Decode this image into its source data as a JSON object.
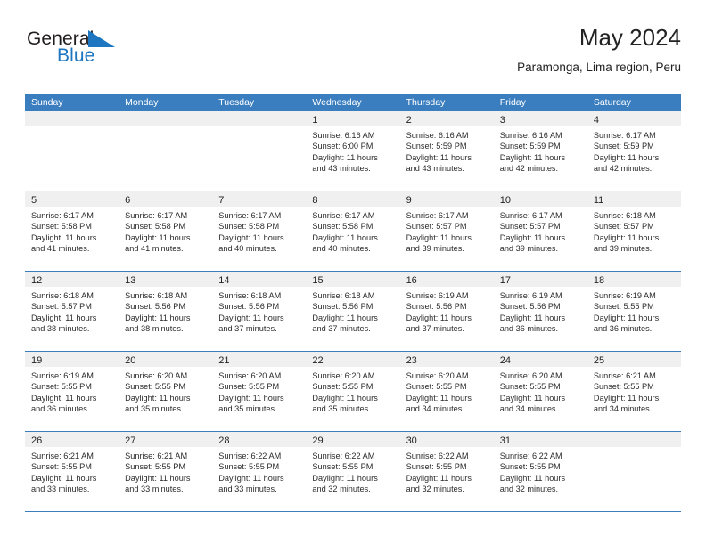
{
  "brand": {
    "line1": "General",
    "line2": "Blue",
    "mark_color": "#1d76bf"
  },
  "header": {
    "title": "May 2024",
    "subtitle": "Paramonga, Lima region, Peru"
  },
  "theme": {
    "header_bg": "#3b7ebf",
    "header_text": "#ffffff",
    "date_band_bg": "#f0f0f0",
    "row_divider": "#3b7ebf"
  },
  "weekdays": [
    "Sunday",
    "Monday",
    "Tuesday",
    "Wednesday",
    "Thursday",
    "Friday",
    "Saturday"
  ],
  "weeks": [
    [
      {
        "day": "",
        "sunrise": "",
        "sunset": "",
        "daylight1": "",
        "daylight2": "",
        "empty": true
      },
      {
        "day": "",
        "sunrise": "",
        "sunset": "",
        "daylight1": "",
        "daylight2": "",
        "empty": true
      },
      {
        "day": "",
        "sunrise": "",
        "sunset": "",
        "daylight1": "",
        "daylight2": "",
        "empty": true
      },
      {
        "day": "1",
        "sunrise": "Sunrise: 6:16 AM",
        "sunset": "Sunset: 6:00 PM",
        "daylight1": "Daylight: 11 hours",
        "daylight2": "and 43 minutes."
      },
      {
        "day": "2",
        "sunrise": "Sunrise: 6:16 AM",
        "sunset": "Sunset: 5:59 PM",
        "daylight1": "Daylight: 11 hours",
        "daylight2": "and 43 minutes."
      },
      {
        "day": "3",
        "sunrise": "Sunrise: 6:16 AM",
        "sunset": "Sunset: 5:59 PM",
        "daylight1": "Daylight: 11 hours",
        "daylight2": "and 42 minutes."
      },
      {
        "day": "4",
        "sunrise": "Sunrise: 6:17 AM",
        "sunset": "Sunset: 5:59 PM",
        "daylight1": "Daylight: 11 hours",
        "daylight2": "and 42 minutes."
      }
    ],
    [
      {
        "day": "5",
        "sunrise": "Sunrise: 6:17 AM",
        "sunset": "Sunset: 5:58 PM",
        "daylight1": "Daylight: 11 hours",
        "daylight2": "and 41 minutes."
      },
      {
        "day": "6",
        "sunrise": "Sunrise: 6:17 AM",
        "sunset": "Sunset: 5:58 PM",
        "daylight1": "Daylight: 11 hours",
        "daylight2": "and 41 minutes."
      },
      {
        "day": "7",
        "sunrise": "Sunrise: 6:17 AM",
        "sunset": "Sunset: 5:58 PM",
        "daylight1": "Daylight: 11 hours",
        "daylight2": "and 40 minutes."
      },
      {
        "day": "8",
        "sunrise": "Sunrise: 6:17 AM",
        "sunset": "Sunset: 5:58 PM",
        "daylight1": "Daylight: 11 hours",
        "daylight2": "and 40 minutes."
      },
      {
        "day": "9",
        "sunrise": "Sunrise: 6:17 AM",
        "sunset": "Sunset: 5:57 PM",
        "daylight1": "Daylight: 11 hours",
        "daylight2": "and 39 minutes."
      },
      {
        "day": "10",
        "sunrise": "Sunrise: 6:17 AM",
        "sunset": "Sunset: 5:57 PM",
        "daylight1": "Daylight: 11 hours",
        "daylight2": "and 39 minutes."
      },
      {
        "day": "11",
        "sunrise": "Sunrise: 6:18 AM",
        "sunset": "Sunset: 5:57 PM",
        "daylight1": "Daylight: 11 hours",
        "daylight2": "and 39 minutes."
      }
    ],
    [
      {
        "day": "12",
        "sunrise": "Sunrise: 6:18 AM",
        "sunset": "Sunset: 5:57 PM",
        "daylight1": "Daylight: 11 hours",
        "daylight2": "and 38 minutes."
      },
      {
        "day": "13",
        "sunrise": "Sunrise: 6:18 AM",
        "sunset": "Sunset: 5:56 PM",
        "daylight1": "Daylight: 11 hours",
        "daylight2": "and 38 minutes."
      },
      {
        "day": "14",
        "sunrise": "Sunrise: 6:18 AM",
        "sunset": "Sunset: 5:56 PM",
        "daylight1": "Daylight: 11 hours",
        "daylight2": "and 37 minutes."
      },
      {
        "day": "15",
        "sunrise": "Sunrise: 6:18 AM",
        "sunset": "Sunset: 5:56 PM",
        "daylight1": "Daylight: 11 hours",
        "daylight2": "and 37 minutes."
      },
      {
        "day": "16",
        "sunrise": "Sunrise: 6:19 AM",
        "sunset": "Sunset: 5:56 PM",
        "daylight1": "Daylight: 11 hours",
        "daylight2": "and 37 minutes."
      },
      {
        "day": "17",
        "sunrise": "Sunrise: 6:19 AM",
        "sunset": "Sunset: 5:56 PM",
        "daylight1": "Daylight: 11 hours",
        "daylight2": "and 36 minutes."
      },
      {
        "day": "18",
        "sunrise": "Sunrise: 6:19 AM",
        "sunset": "Sunset: 5:55 PM",
        "daylight1": "Daylight: 11 hours",
        "daylight2": "and 36 minutes."
      }
    ],
    [
      {
        "day": "19",
        "sunrise": "Sunrise: 6:19 AM",
        "sunset": "Sunset: 5:55 PM",
        "daylight1": "Daylight: 11 hours",
        "daylight2": "and 36 minutes."
      },
      {
        "day": "20",
        "sunrise": "Sunrise: 6:20 AM",
        "sunset": "Sunset: 5:55 PM",
        "daylight1": "Daylight: 11 hours",
        "daylight2": "and 35 minutes."
      },
      {
        "day": "21",
        "sunrise": "Sunrise: 6:20 AM",
        "sunset": "Sunset: 5:55 PM",
        "daylight1": "Daylight: 11 hours",
        "daylight2": "and 35 minutes."
      },
      {
        "day": "22",
        "sunrise": "Sunrise: 6:20 AM",
        "sunset": "Sunset: 5:55 PM",
        "daylight1": "Daylight: 11 hours",
        "daylight2": "and 35 minutes."
      },
      {
        "day": "23",
        "sunrise": "Sunrise: 6:20 AM",
        "sunset": "Sunset: 5:55 PM",
        "daylight1": "Daylight: 11 hours",
        "daylight2": "and 34 minutes."
      },
      {
        "day": "24",
        "sunrise": "Sunrise: 6:20 AM",
        "sunset": "Sunset: 5:55 PM",
        "daylight1": "Daylight: 11 hours",
        "daylight2": "and 34 minutes."
      },
      {
        "day": "25",
        "sunrise": "Sunrise: 6:21 AM",
        "sunset": "Sunset: 5:55 PM",
        "daylight1": "Daylight: 11 hours",
        "daylight2": "and 34 minutes."
      }
    ],
    [
      {
        "day": "26",
        "sunrise": "Sunrise: 6:21 AM",
        "sunset": "Sunset: 5:55 PM",
        "daylight1": "Daylight: 11 hours",
        "daylight2": "and 33 minutes."
      },
      {
        "day": "27",
        "sunrise": "Sunrise: 6:21 AM",
        "sunset": "Sunset: 5:55 PM",
        "daylight1": "Daylight: 11 hours",
        "daylight2": "and 33 minutes."
      },
      {
        "day": "28",
        "sunrise": "Sunrise: 6:22 AM",
        "sunset": "Sunset: 5:55 PM",
        "daylight1": "Daylight: 11 hours",
        "daylight2": "and 33 minutes."
      },
      {
        "day": "29",
        "sunrise": "Sunrise: 6:22 AM",
        "sunset": "Sunset: 5:55 PM",
        "daylight1": "Daylight: 11 hours",
        "daylight2": "and 32 minutes."
      },
      {
        "day": "30",
        "sunrise": "Sunrise: 6:22 AM",
        "sunset": "Sunset: 5:55 PM",
        "daylight1": "Daylight: 11 hours",
        "daylight2": "and 32 minutes."
      },
      {
        "day": "31",
        "sunrise": "Sunrise: 6:22 AM",
        "sunset": "Sunset: 5:55 PM",
        "daylight1": "Daylight: 11 hours",
        "daylight2": "and 32 minutes."
      },
      {
        "day": "",
        "sunrise": "",
        "sunset": "",
        "daylight1": "",
        "daylight2": "",
        "empty": true
      }
    ]
  ]
}
